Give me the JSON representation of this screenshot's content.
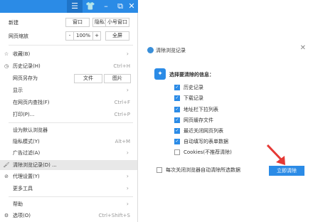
{
  "menu": {
    "titlebar_icons": [
      "menu-icon",
      "skin-icon",
      "minimize-icon",
      "restore-icon",
      "close-icon"
    ],
    "new_window": {
      "label": "新建",
      "options": [
        "窗口",
        "隐私窗口",
        "小号窗口"
      ]
    },
    "zoom": {
      "label": "网页缩放",
      "minus": "-",
      "value": "100%",
      "plus": "+",
      "full": "全屏"
    },
    "items": [
      {
        "label": "收藏(B)",
        "shortcut": "",
        "arrow": true,
        "icon": "star-icon"
      },
      {
        "label": "历史记录(H)",
        "shortcut": "Ctrl+H",
        "arrow": false,
        "icon": "clock-icon"
      },
      {
        "label": "网页另存为",
        "shortcut": "",
        "arrow": false,
        "icon": "",
        "buttons": [
          "文件",
          "图片"
        ]
      },
      {
        "label": "显示",
        "shortcut": "",
        "arrow": true,
        "icon": ""
      },
      {
        "label": "在网页内查找(F)",
        "shortcut": "Ctrl+F",
        "arrow": false,
        "icon": ""
      },
      {
        "label": "打印(P)...",
        "shortcut": "Ctrl+P",
        "arrow": false,
        "icon": ""
      },
      {
        "label": "设为默认浏览器",
        "shortcut": "",
        "arrow": false,
        "icon": ""
      },
      {
        "label": "隐私模式(Y)",
        "shortcut": "Alt+M",
        "arrow": false,
        "icon": ""
      },
      {
        "label": "广告过滤(A)",
        "shortcut": "",
        "arrow": true,
        "icon": ""
      },
      {
        "label": "清除浏览记录(D) ...",
        "shortcut": "",
        "arrow": false,
        "icon": "broom-icon",
        "highlighted": true
      },
      {
        "label": "代理设置(Y)",
        "shortcut": "",
        "arrow": true,
        "icon": "proxy-icon"
      },
      {
        "label": "更多工具",
        "shortcut": "",
        "arrow": true,
        "icon": ""
      },
      {
        "label": "帮助",
        "shortcut": "",
        "arrow": true,
        "icon": ""
      },
      {
        "label": "选项(O)",
        "shortcut": "Ctrl+Shift+S",
        "arrow": false,
        "icon": "gear-icon"
      }
    ]
  },
  "dialog": {
    "title": "清除浏览记录",
    "prompt": "选择要清除的信息：",
    "options": [
      {
        "label": "历史记录",
        "checked": true
      },
      {
        "label": "下载记录",
        "checked": true
      },
      {
        "label": "地址栏下拉列表",
        "checked": true
      },
      {
        "label": "网页缓存文件",
        "checked": true
      },
      {
        "label": "最近关闭网页列表",
        "checked": true
      },
      {
        "label": "自动填写的表单数据",
        "checked": true
      },
      {
        "label": "Cookies(不推荐清除)",
        "checked": false
      }
    ],
    "auto_clear": {
      "label": "每次关闭浏览器自动清除所选数据",
      "checked": false
    },
    "clear_button": "立即清除"
  },
  "colors": {
    "accent": "#2b8be6",
    "annotation_arrow": "#e53935"
  }
}
